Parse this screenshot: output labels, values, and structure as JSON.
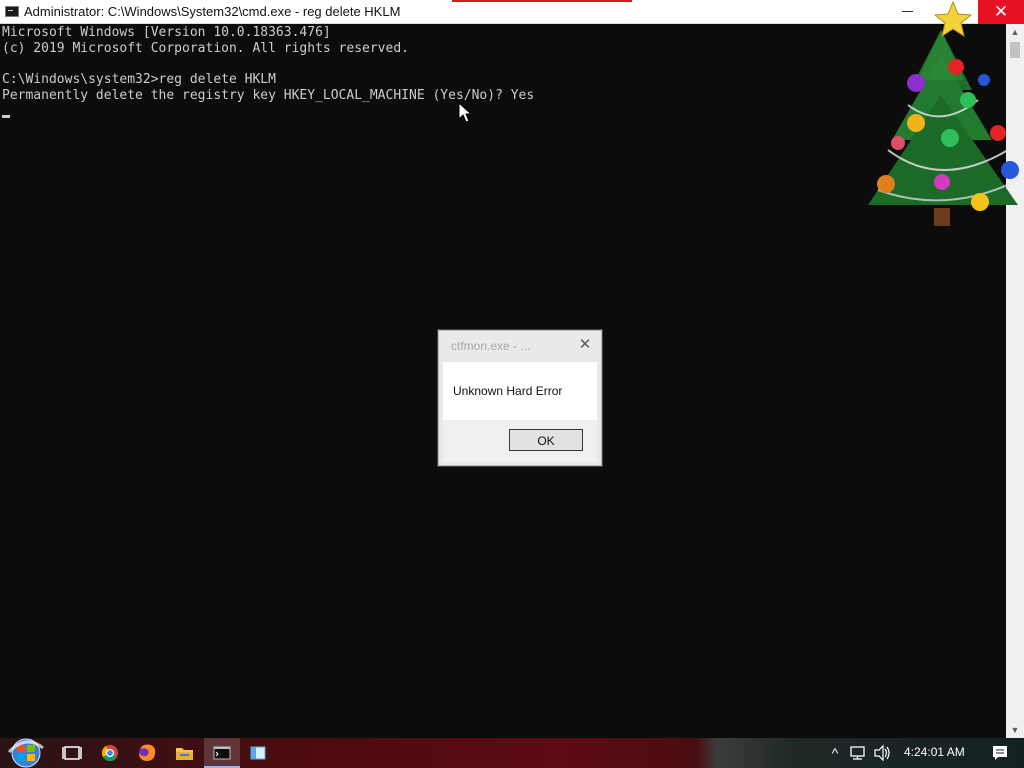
{
  "window": {
    "title": "Administrator: C:\\Windows\\System32\\cmd.exe - reg  delete HKLM",
    "close_symbol": "✕",
    "icon": "cmd-icon"
  },
  "console": {
    "lines": [
      "Microsoft Windows [Version 10.0.18363.476]",
      "(c) 2019 Microsoft Corporation. All rights reserved.",
      "",
      "C:\\Windows\\system32>reg delete HKLM",
      "Permanently delete the registry key HKEY_LOCAL_MACHINE (Yes/No)? Yes"
    ],
    "text_color": "#cccccc",
    "background": "#0c0c0c"
  },
  "scrollbar": {
    "up_symbol": "▲",
    "down_symbol": "▼"
  },
  "dialog": {
    "title": "ctfmon.exe - ...",
    "close_symbol": "✕",
    "message": "Unknown Hard Error",
    "ok_label": "OK"
  },
  "taskbar": {
    "pinned": [
      "start-orb-icon",
      "task-view-icon",
      "chrome-icon",
      "firefox-icon",
      "file-explorer-icon",
      "cmd-icon",
      "app-icon"
    ],
    "tray": {
      "chevron": "^",
      "clock": "4:24:01 AM"
    }
  },
  "colors": {
    "close_red": "#e81123",
    "taskbar_red": "#5e0a12"
  }
}
